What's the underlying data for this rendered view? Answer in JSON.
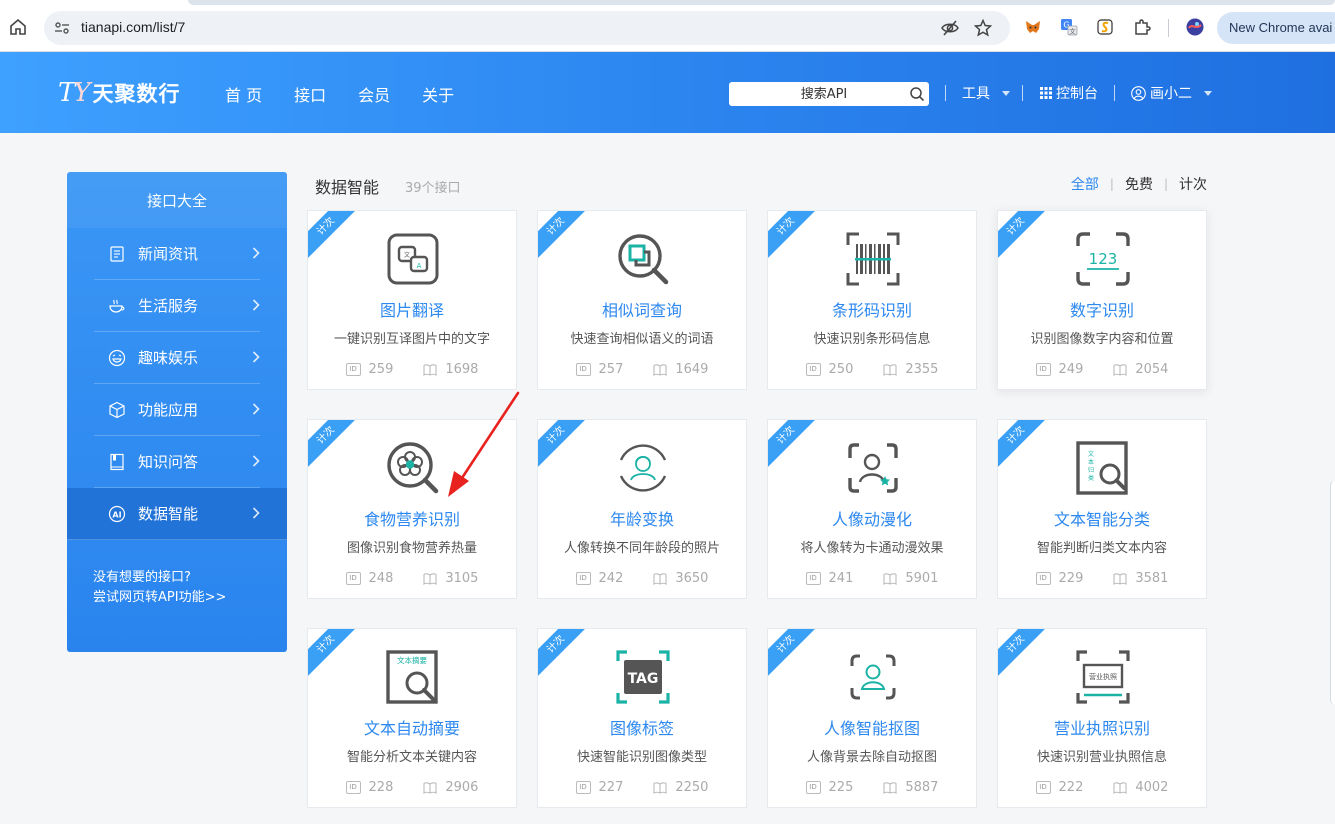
{
  "browser": {
    "url": "tianapi.com/list/7",
    "new_chrome_label": "New Chrome avai"
  },
  "site": {
    "logo_mark_t": "T",
    "logo_mark_y": "Y",
    "logo_text": "天聚数行",
    "nav": [
      "首 页",
      "接口",
      "会员",
      "关于"
    ],
    "search_placeholder": "搜索API",
    "tools_label": "工具",
    "console_label": "控制台",
    "user_label": "画小二"
  },
  "sidebar": {
    "title": "接口大全",
    "items": [
      {
        "label": "新闻资讯",
        "icon": "news-icon"
      },
      {
        "label": "生活服务",
        "icon": "coffee-icon"
      },
      {
        "label": "趣味娱乐",
        "icon": "smile-icon"
      },
      {
        "label": "功能应用",
        "icon": "cube-icon"
      },
      {
        "label": "知识问答",
        "icon": "book-icon"
      },
      {
        "label": "数据智能",
        "icon": "ai-icon",
        "active": true
      }
    ],
    "footer_line1": "没有想要的接口?",
    "footer_line2": "尝试网页转API功能>>"
  },
  "content": {
    "title": "数据智能",
    "count": "39个接口",
    "filters": [
      "全部",
      "免费",
      "计次"
    ],
    "ribbon": "计次",
    "cards": [
      {
        "name": "图片翻译",
        "desc": "一键识别互译图片中的文字",
        "id": "259",
        "reads": "1698",
        "icon": "image-translate-icon"
      },
      {
        "name": "相似词查询",
        "desc": "快速查询相似语义的词语",
        "id": "257",
        "reads": "1649",
        "icon": "similar-search-icon"
      },
      {
        "name": "条形码识别",
        "desc": "快速识别条形码信息",
        "id": "250",
        "reads": "2355",
        "icon": "barcode-icon"
      },
      {
        "name": "数字识别",
        "desc": "识别图像数字内容和位置",
        "id": "249",
        "reads": "2054",
        "icon": "digit-scan-icon",
        "icon_text": "123"
      },
      {
        "name": "食物营养识别",
        "desc": "图像识别食物营养热量",
        "id": "248",
        "reads": "3105",
        "icon": "food-search-icon"
      },
      {
        "name": "年龄变换",
        "desc": "人像转换不同年龄段的照片",
        "id": "242",
        "reads": "3650",
        "icon": "age-change-icon"
      },
      {
        "name": "人像动漫化",
        "desc": "将人像转为卡通动漫效果",
        "id": "241",
        "reads": "5901",
        "icon": "portrait-anime-icon"
      },
      {
        "name": "文本智能分类",
        "desc": "智能判断归类文本内容",
        "id": "229",
        "reads": "3581",
        "icon": "text-classify-icon",
        "icon_text": "文本归类"
      },
      {
        "name": "文本自动摘要",
        "desc": "智能分析文本关键内容",
        "id": "228",
        "reads": "2906",
        "icon": "text-summary-icon",
        "icon_text": "文本摘要"
      },
      {
        "name": "图像标签",
        "desc": "快速智能识别图像类型",
        "id": "227",
        "reads": "2250",
        "icon": "tag-icon",
        "icon_text": "TAG"
      },
      {
        "name": "人像智能抠图",
        "desc": "人像背景去除自动抠图",
        "id": "225",
        "reads": "5887",
        "icon": "portrait-cutout-icon"
      },
      {
        "name": "营业执照识别",
        "desc": "快速识别营业执照信息",
        "id": "222",
        "reads": "4002",
        "icon": "license-icon",
        "icon_text": "营业执照"
      }
    ]
  },
  "colors": {
    "brand_blue": "#2d88ef",
    "header_gradient_start": "#3ea0ff",
    "header_gradient_end": "#1f6fe0",
    "ribbon": "#3aa0f5",
    "teal_accent": "#1ab3a6",
    "annotation_arrow": "#e8231f"
  }
}
